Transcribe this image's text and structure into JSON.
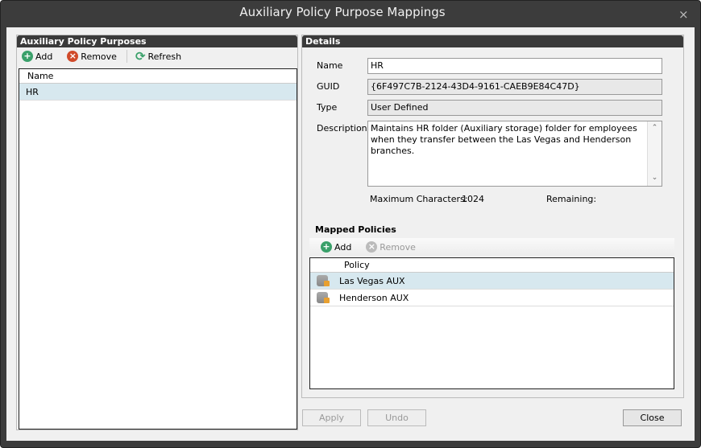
{
  "window": {
    "title": "Auxiliary Policy Purpose Mappings",
    "close": "×"
  },
  "left": {
    "header": "Auxiliary Policy Purposes",
    "add": "Add",
    "remove": "Remove",
    "refresh": "Refresh",
    "column": "Name",
    "rows": [
      "HR"
    ]
  },
  "details": {
    "header": "Details",
    "name_label": "Name",
    "name_value": "HR",
    "guid_label": "GUID",
    "guid_value": "{6F497C7B-2124-43D4-9161-CAEB9E84C47D}",
    "type_label": "Type",
    "type_value": "User Defined",
    "desc_label": "Description",
    "desc_value": "Maintains HR folder (Auxiliary storage) folder  for employees when they transfer between the Las Vegas and Henderson branches.",
    "max_label": "Maximum Characters:",
    "max_value": "1024",
    "remaining_label": "Remaining:"
  },
  "mapped": {
    "header": "Mapped Policies",
    "add": "Add",
    "remove": "Remove",
    "column": "Policy",
    "rows": [
      "Las Vegas AUX",
      "Henderson AUX"
    ]
  },
  "buttons": {
    "apply": "Apply",
    "undo": "Undo",
    "close": "Close"
  }
}
